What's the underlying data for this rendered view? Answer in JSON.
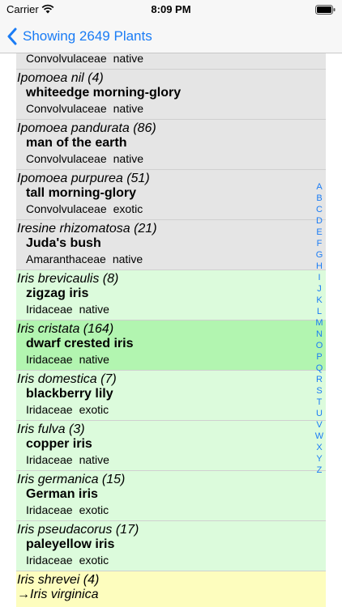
{
  "status_bar": {
    "carrier": "Carrier",
    "time": "8:09 PM"
  },
  "nav": {
    "back_label": "Showing 2649 Plants"
  },
  "plants": [
    {
      "scientific": "",
      "common": "",
      "family": "Convolvulaceae",
      "status": "native",
      "color": "gray"
    },
    {
      "scientific": "Ipomoea nil  (4)",
      "common": "whiteedge morning-glory",
      "family": "Convolvulaceae",
      "status": "native",
      "color": "gray"
    },
    {
      "scientific": "Ipomoea pandurata  (86)",
      "common": "man of the earth",
      "family": "Convolvulaceae",
      "status": "native",
      "color": "gray"
    },
    {
      "scientific": "Ipomoea purpurea  (51)",
      "common": "tall morning-glory",
      "family": "Convolvulaceae",
      "status": "exotic",
      "color": "gray"
    },
    {
      "scientific": "Iresine rhizomatosa  (21)",
      "common": "Juda's bush",
      "family": "Amaranthaceae",
      "status": "native",
      "color": "gray"
    },
    {
      "scientific": "Iris brevicaulis  (8)",
      "common": "zigzag iris",
      "family": "Iridaceae",
      "status": "native",
      "color": "green"
    },
    {
      "scientific": "Iris cristata  (164)",
      "common": "dwarf crested iris",
      "family": "Iridaceae",
      "status": "native",
      "color": "green-strong"
    },
    {
      "scientific": "Iris domestica  (7)",
      "common": "blackberry lily",
      "family": "Iridaceae",
      "status": "exotic",
      "color": "green"
    },
    {
      "scientific": "Iris fulva  (3)",
      "common": "copper iris",
      "family": "Iridaceae",
      "status": "native",
      "color": "green"
    },
    {
      "scientific": "Iris germanica  (15)",
      "common": "German iris",
      "family": "Iridaceae",
      "status": "exotic",
      "color": "green"
    },
    {
      "scientific": "Iris pseudacorus  (17)",
      "common": "paleyellow iris",
      "family": "Iridaceae",
      "status": "exotic",
      "color": "green"
    },
    {
      "scientific": "Iris shrevei  (4)",
      "synonym": "→Iris virginica",
      "color": "yellow"
    }
  ],
  "index_letters": [
    "A",
    "B",
    "C",
    "D",
    "E",
    "F",
    "G",
    "H",
    "I",
    "J",
    "K",
    "L",
    "M",
    "N",
    "O",
    "P",
    "Q",
    "R",
    "S",
    "T",
    "U",
    "V",
    "W",
    "X",
    "Y",
    "Z"
  ],
  "colors": {
    "accent": "#1a7cf5",
    "gray_row": "#e5e5e5",
    "green_row": "#dcfbdc",
    "green_selected": "#b2f5b0",
    "yellow_row": "#fdfdbe"
  },
  "icons": {
    "back": "chevron-left-icon",
    "wifi": "wifi-icon",
    "battery": "battery-icon"
  }
}
